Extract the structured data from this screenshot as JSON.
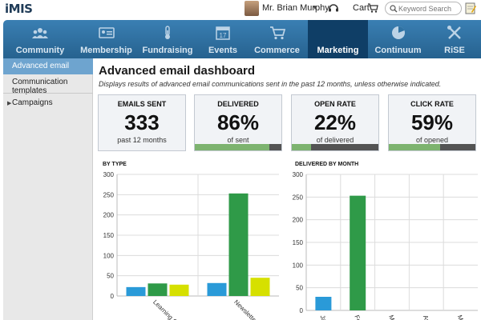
{
  "header": {
    "logo": "iMIS",
    "user_name": "Mr. Brian Murphy",
    "cart_label": "Cart",
    "search_placeholder": "Keyword Search"
  },
  "nav": {
    "items": [
      {
        "label": "Community",
        "icon": "community-icon"
      },
      {
        "label": "Membership",
        "icon": "membership-card-icon"
      },
      {
        "label": "Fundraising",
        "icon": "thermometer-icon"
      },
      {
        "label": "Events",
        "icon": "calendar-icon",
        "icon_text": "17"
      },
      {
        "label": "Commerce",
        "icon": "shopping-cart-icon"
      },
      {
        "label": "Marketing",
        "icon": "megaphone-icon",
        "active": true
      },
      {
        "label": "Continuum",
        "icon": "pie-chart-icon"
      },
      {
        "label": "RiSE",
        "icon": "tools-icon"
      }
    ]
  },
  "sidebar": {
    "items": [
      {
        "label": "Advanced email",
        "active": true
      },
      {
        "label": "Communication templates"
      },
      {
        "label": "Campaigns",
        "expandable": true
      }
    ]
  },
  "page": {
    "title": "Advanced email dashboard",
    "description": "Displays results of advanced email communications sent in the past 12 months, unless otherwise indicated."
  },
  "cards": [
    {
      "label": "EMAILS SENT",
      "value": "333",
      "sub": "past 12 months"
    },
    {
      "label": "DELIVERED",
      "value": "86%",
      "sub": "of sent",
      "progress": 0.86
    },
    {
      "label": "OPEN RATE",
      "value": "22%",
      "sub": "of delivered",
      "progress": 0.22
    },
    {
      "label": "CLICK RATE",
      "value": "59%",
      "sub": "of opened",
      "progress": 0.59
    }
  ],
  "colors": {
    "nav_bg": "#2f72a3",
    "nav_active": "#0f3e66",
    "sidebar_active": "#6ea4cf",
    "series_blue": "#2a9ad8",
    "series_green": "#2f9a48",
    "series_yellow": "#d6e000",
    "progress_fill": "#7db36f"
  },
  "chart_data": [
    {
      "type": "bar",
      "title": "BY TYPE",
      "categories": [
        "Learning C",
        "Newsletter"
      ],
      "series": [
        {
          "values": [
            22,
            32
          ],
          "color": "#2a9ad8"
        },
        {
          "values": [
            31,
            253
          ],
          "color": "#2f9a48"
        },
        {
          "values": [
            28,
            45
          ],
          "color": "#d6e000"
        }
      ],
      "yticks": [
        0,
        50,
        100,
        150,
        200,
        250,
        300
      ],
      "ylim": [
        0,
        300
      ],
      "grid": true
    },
    {
      "type": "bar",
      "title": "DELIVERED BY MONTH",
      "categories": [
        "Ja",
        "Fe",
        "Ma",
        "Ap",
        "Ma"
      ],
      "values": [
        30,
        253,
        0,
        0,
        0
      ],
      "colors": [
        "#2a9ad8",
        "#2f9a48",
        "#2a9ad8",
        "#2a9ad8",
        "#2a9ad8"
      ],
      "yticks": [
        0,
        50,
        100,
        150,
        200,
        250,
        300
      ],
      "ylim": [
        0,
        300
      ],
      "grid": true
    }
  ]
}
